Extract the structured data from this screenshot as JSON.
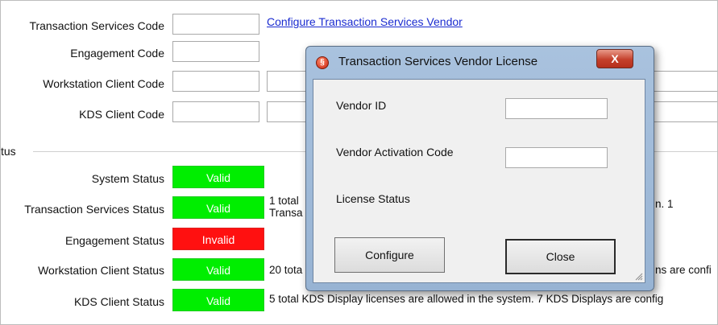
{
  "fields": {
    "transaction_services_code": "Transaction Services Code",
    "engagement_code": "Engagement Code",
    "workstation_client_code": "Workstation Client Code",
    "kds_client_code": "KDS Client Code"
  },
  "configure_link": "Configure Transaction Services Vendor",
  "status_group": {
    "title": "tus",
    "rows": [
      {
        "label": "System Status",
        "state": "Valid",
        "desc1": "",
        "desc2": ""
      },
      {
        "label": "Transaction Services Status",
        "state": "Valid",
        "desc1": "1 total",
        "desc2": "Transa",
        "tail": "n. 1"
      },
      {
        "label": "Engagement Status",
        "state": "Invalid",
        "desc1": "",
        "desc2": ""
      },
      {
        "label": "Workstation Client Status",
        "state": "Valid",
        "desc1": "20 tota",
        "tail": "ns are confi"
      },
      {
        "label": "KDS Client Status",
        "state": "Valid",
        "desc1": "5 total KDS Display licenses are allowed in the system. 7 KDS Displays are config"
      }
    ]
  },
  "dialog": {
    "title": "Transaction Services Vendor License",
    "close_glyph": "X",
    "vendor_id_label": "Vendor ID",
    "vendor_id_value": "",
    "activation_label": "Vendor Activation Code",
    "activation_value": "",
    "license_status_label": "License Status",
    "configure_button": "Configure",
    "close_button": "Close"
  },
  "colors": {
    "valid": "#00ee00",
    "invalid": "#ff1010",
    "link": "#1a2bd0"
  }
}
